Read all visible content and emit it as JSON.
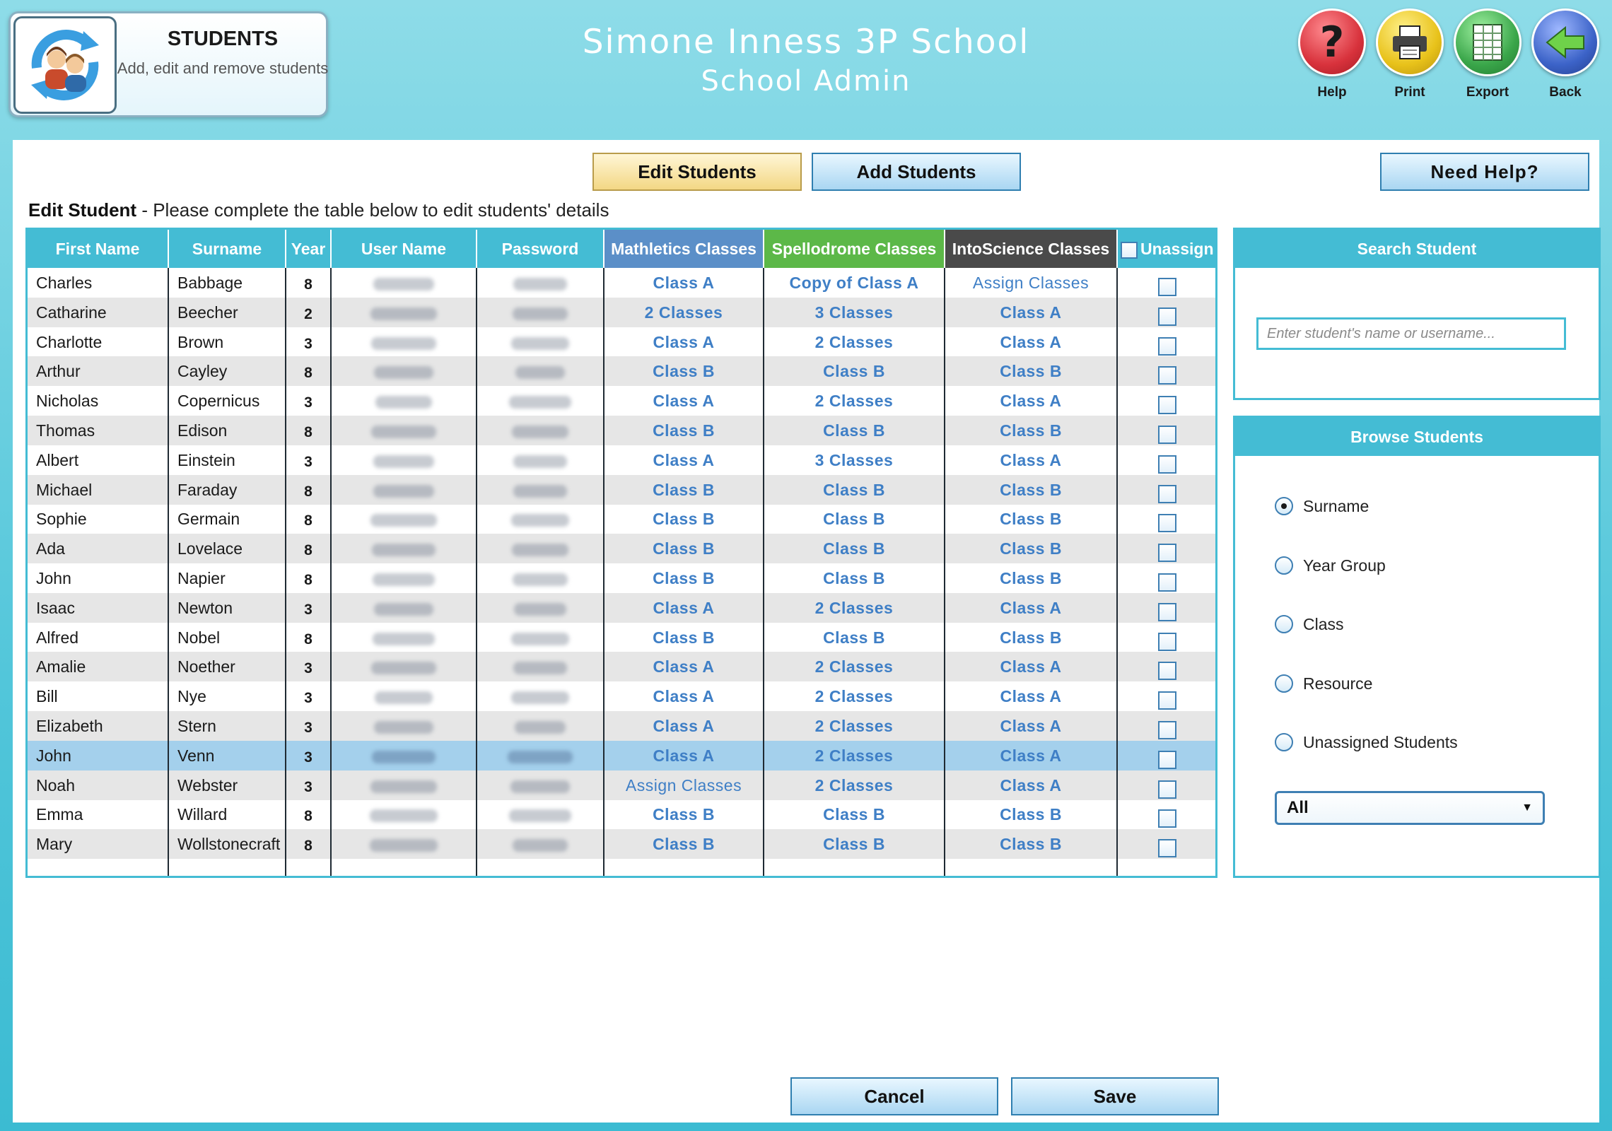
{
  "header": {
    "section_title": "STUDENTS",
    "section_subtitle": "Add, edit and remove students",
    "school_name": "Simone Inness 3P School",
    "school_subtitle": "School Admin",
    "buttons": [
      {
        "label": "Help",
        "icon": "question-icon",
        "color": "#d8323c"
      },
      {
        "label": "Print",
        "icon": "printer-icon",
        "color": "#e8c21a"
      },
      {
        "label": "Export",
        "icon": "spreadsheet-icon",
        "color": "#3aa64a"
      },
      {
        "label": "Back",
        "icon": "back-arrow-icon",
        "color": "#3c63c8"
      }
    ]
  },
  "tabs": {
    "edit_label": "Edit Students",
    "add_label": "Add Students",
    "help_label": "Need Help?"
  },
  "instruction": {
    "bold": "Edit Student",
    "text": " - Please complete the table below to edit students' details"
  },
  "table": {
    "columns": [
      "First Name",
      "Surname",
      "Year",
      "User Name",
      "Password",
      "Mathletics Classes",
      "Spellodrome Classes",
      "IntoScience Classes",
      "Unassign"
    ],
    "header_colors": {
      "mathletics": "#5b8fc8",
      "spellodrome": "#5cb848",
      "intoscience": "#4a4a4a",
      "default": "#44bcd4"
    },
    "rows": [
      {
        "first": "Charles",
        "surname": "Babbage",
        "year": "8",
        "math": "Class A",
        "spell": "Copy of Class A",
        "science": "Assign Classes"
      },
      {
        "first": "Catharine",
        "surname": "Beecher",
        "year": "2",
        "math": "2 Classes",
        "spell": "3 Classes",
        "science": "Class A"
      },
      {
        "first": "Charlotte",
        "surname": "Brown",
        "year": "3",
        "math": "Class A",
        "spell": "2 Classes",
        "science": "Class A"
      },
      {
        "first": "Arthur",
        "surname": "Cayley",
        "year": "8",
        "math": "Class B",
        "spell": "Class B",
        "science": "Class B"
      },
      {
        "first": "Nicholas",
        "surname": "Copernicus",
        "year": "3",
        "math": "Class A",
        "spell": "2 Classes",
        "science": "Class A"
      },
      {
        "first": "Thomas",
        "surname": "Edison",
        "year": "8",
        "math": "Class B",
        "spell": "Class B",
        "science": "Class B"
      },
      {
        "first": "Albert",
        "surname": "Einstein",
        "year": "3",
        "math": "Class A",
        "spell": "3 Classes",
        "science": "Class A"
      },
      {
        "first": "Michael",
        "surname": "Faraday",
        "year": "8",
        "math": "Class B",
        "spell": "Class B",
        "science": "Class B"
      },
      {
        "first": "Sophie",
        "surname": "Germain",
        "year": "8",
        "math": "Class B",
        "spell": "Class B",
        "science": "Class B"
      },
      {
        "first": "Ada",
        "surname": "Lovelace",
        "year": "8",
        "math": "Class B",
        "spell": "Class B",
        "science": "Class B"
      },
      {
        "first": "John",
        "surname": "Napier",
        "year": "8",
        "math": "Class B",
        "spell": "Class B",
        "science": "Class B"
      },
      {
        "first": "Isaac",
        "surname": "Newton",
        "year": "3",
        "math": "Class A",
        "spell": "2 Classes",
        "science": "Class A"
      },
      {
        "first": "Alfred",
        "surname": "Nobel",
        "year": "8",
        "math": "Class B",
        "spell": "Class B",
        "science": "Class B"
      },
      {
        "first": "Amalie",
        "surname": "Noether",
        "year": "3",
        "math": "Class A",
        "spell": "2 Classes",
        "science": "Class A"
      },
      {
        "first": "Bill",
        "surname": "Nye",
        "year": "3",
        "math": "Class A",
        "spell": "2 Classes",
        "science": "Class A"
      },
      {
        "first": "Elizabeth",
        "surname": "Stern",
        "year": "3",
        "math": "Class A",
        "spell": "2 Classes",
        "science": "Class A"
      },
      {
        "first": "John",
        "surname": "Venn",
        "year": "3",
        "math": "Class A",
        "spell": "2 Classes",
        "science": "Class A",
        "selected": true
      },
      {
        "first": "Noah",
        "surname": "Webster",
        "year": "3",
        "math": "Assign Classes",
        "spell": "2 Classes",
        "science": "Class A"
      },
      {
        "first": "Emma",
        "surname": "Willard",
        "year": "8",
        "math": "Class B",
        "spell": "Class B",
        "science": "Class B"
      },
      {
        "first": "Mary",
        "surname": "Wollstonecraft",
        "year": "8",
        "math": "Class B",
        "spell": "Class B",
        "science": "Class B"
      }
    ]
  },
  "search": {
    "title": "Search Student",
    "placeholder": "Enter student's name or username..."
  },
  "browse": {
    "title": "Browse Students",
    "options": [
      "Surname",
      "Year Group",
      "Class",
      "Resource",
      "Unassigned Students"
    ],
    "selected": "Surname",
    "filter_value": "All"
  },
  "footer": {
    "cancel_label": "Cancel",
    "save_label": "Save"
  }
}
